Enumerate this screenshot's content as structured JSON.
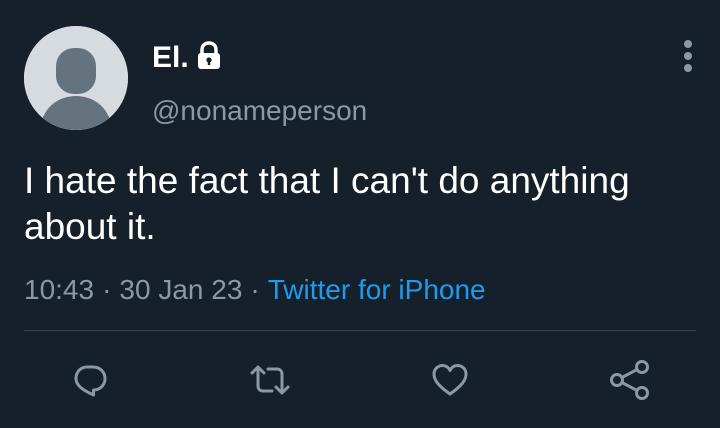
{
  "tweet": {
    "display_name": "El.",
    "handle": "@nonameperson",
    "text": "I hate the fact that I can't do anything about it.",
    "time": "10:43",
    "separator": "·",
    "date": "30 Jan 23",
    "source": "Twitter for iPhone",
    "protected_icon": "lock-icon",
    "more_icon": "vertical-ellipsis-icon"
  },
  "actions": [
    {
      "name": "reply",
      "icon": "speech-bubble-icon"
    },
    {
      "name": "retweet",
      "icon": "retweet-arrows-icon"
    },
    {
      "name": "like",
      "icon": "heart-icon"
    },
    {
      "name": "share",
      "icon": "share-nodes-icon"
    }
  ],
  "colors": {
    "background": "#15202b",
    "primary_text": "#ffffff",
    "secondary_text": "#8b98a5",
    "link": "#1d9bf0",
    "divider": "#38444d"
  }
}
